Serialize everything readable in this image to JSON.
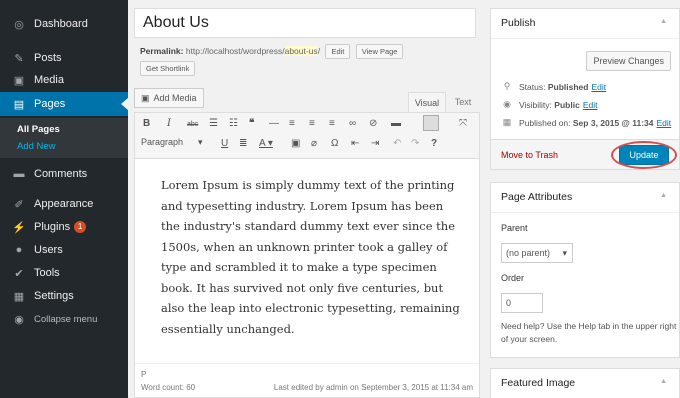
{
  "sidebar": {
    "items": [
      {
        "label": "Dashboard",
        "icon": "dashboard-icon"
      },
      {
        "label": "Posts",
        "icon": "pushpin-icon"
      },
      {
        "label": "Media",
        "icon": "media-icon"
      },
      {
        "label": "Pages",
        "icon": "pages-icon"
      },
      {
        "label": "Comments",
        "icon": "comment-icon"
      },
      {
        "label": "Appearance",
        "icon": "brush-icon"
      },
      {
        "label": "Plugins",
        "icon": "plugin-icon",
        "badge": "1"
      },
      {
        "label": "Users",
        "icon": "users-icon"
      },
      {
        "label": "Tools",
        "icon": "wrench-icon"
      },
      {
        "label": "Settings",
        "icon": "settings-icon"
      },
      {
        "label": "Collapse menu",
        "icon": "collapse-icon"
      }
    ],
    "submenu": {
      "all_pages": "All Pages",
      "add_new": "Add New"
    }
  },
  "editor": {
    "title": "About Us",
    "permalink_label": "Permalink:",
    "permalink_base": "http://localhost/wordpress/",
    "permalink_slug": "about-us",
    "permalink_end": "/",
    "edit_btn": "Edit",
    "view_page_btn": "View Page",
    "shortlink_btn": "Get Shortlink",
    "add_media": "Add Media",
    "tab_visual": "Visual",
    "tab_text": "Text",
    "format": "Paragraph",
    "content": "Lorem Ipsum is simply dummy text of the printing and typesetting industry. Lorem Ipsum has been the industry's standard dummy text ever since the 1500s, when an unknown printer took a galley of type and scrambled it to make a type specimen book. It has survived not only five centuries, but also the leap into electronic typesetting, remaining essentially unchanged.",
    "path": "P",
    "word_count": "Word count: 60",
    "last_edited": "Last edited by admin on September 3, 2015 at 11:34 am"
  },
  "publish": {
    "title": "Publish",
    "preview_btn": "Preview Changes",
    "status_label": "Status:",
    "status_value": "Published",
    "visibility_label": "Visibility:",
    "visibility_value": "Public",
    "published_label": "Published on:",
    "published_value": "Sep 3, 2015 @ 11:34",
    "edit_link": "Edit",
    "trash": "Move to Trash",
    "update_btn": "Update"
  },
  "page_attributes": {
    "title": "Page Attributes",
    "parent_label": "Parent",
    "parent_value": "(no parent)",
    "order_label": "Order",
    "order_value": "0",
    "help": "Need help? Use the Help tab in the upper right of your screen."
  },
  "featured_image": {
    "title": "Featured Image"
  },
  "colors": {
    "sidebar": "#23282d",
    "accent": "#0073aa",
    "button": "#0085ba",
    "highlight_ring": "#d54e4e"
  }
}
